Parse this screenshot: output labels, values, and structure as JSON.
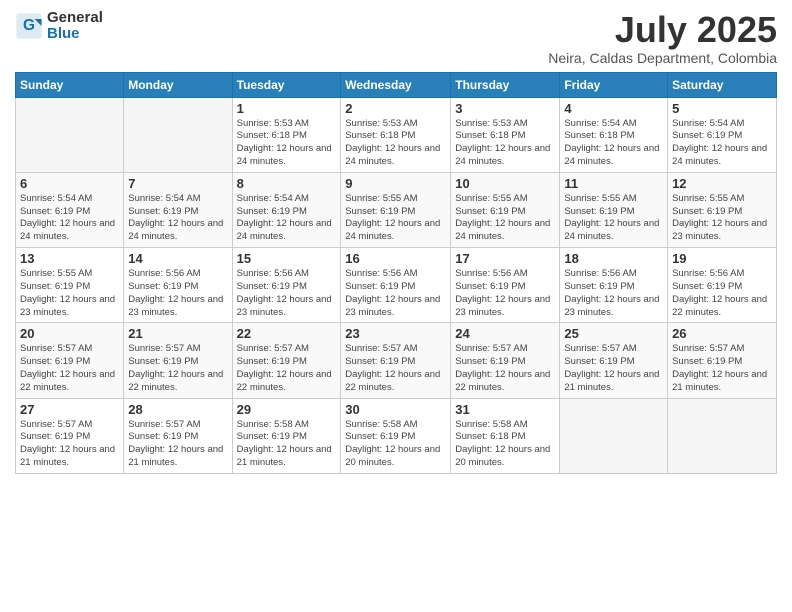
{
  "logo": {
    "text_general": "General",
    "text_blue": "Blue"
  },
  "title": {
    "month": "July 2025",
    "location": "Neira, Caldas Department, Colombia"
  },
  "weekdays": [
    "Sunday",
    "Monday",
    "Tuesday",
    "Wednesday",
    "Thursday",
    "Friday",
    "Saturday"
  ],
  "weeks": [
    [
      {
        "day": "",
        "info": ""
      },
      {
        "day": "",
        "info": ""
      },
      {
        "day": "1",
        "info": "Sunrise: 5:53 AM\nSunset: 6:18 PM\nDaylight: 12 hours and 24 minutes."
      },
      {
        "day": "2",
        "info": "Sunrise: 5:53 AM\nSunset: 6:18 PM\nDaylight: 12 hours and 24 minutes."
      },
      {
        "day": "3",
        "info": "Sunrise: 5:53 AM\nSunset: 6:18 PM\nDaylight: 12 hours and 24 minutes."
      },
      {
        "day": "4",
        "info": "Sunrise: 5:54 AM\nSunset: 6:18 PM\nDaylight: 12 hours and 24 minutes."
      },
      {
        "day": "5",
        "info": "Sunrise: 5:54 AM\nSunset: 6:19 PM\nDaylight: 12 hours and 24 minutes."
      }
    ],
    [
      {
        "day": "6",
        "info": "Sunrise: 5:54 AM\nSunset: 6:19 PM\nDaylight: 12 hours and 24 minutes."
      },
      {
        "day": "7",
        "info": "Sunrise: 5:54 AM\nSunset: 6:19 PM\nDaylight: 12 hours and 24 minutes."
      },
      {
        "day": "8",
        "info": "Sunrise: 5:54 AM\nSunset: 6:19 PM\nDaylight: 12 hours and 24 minutes."
      },
      {
        "day": "9",
        "info": "Sunrise: 5:55 AM\nSunset: 6:19 PM\nDaylight: 12 hours and 24 minutes."
      },
      {
        "day": "10",
        "info": "Sunrise: 5:55 AM\nSunset: 6:19 PM\nDaylight: 12 hours and 24 minutes."
      },
      {
        "day": "11",
        "info": "Sunrise: 5:55 AM\nSunset: 6:19 PM\nDaylight: 12 hours and 24 minutes."
      },
      {
        "day": "12",
        "info": "Sunrise: 5:55 AM\nSunset: 6:19 PM\nDaylight: 12 hours and 23 minutes."
      }
    ],
    [
      {
        "day": "13",
        "info": "Sunrise: 5:55 AM\nSunset: 6:19 PM\nDaylight: 12 hours and 23 minutes."
      },
      {
        "day": "14",
        "info": "Sunrise: 5:56 AM\nSunset: 6:19 PM\nDaylight: 12 hours and 23 minutes."
      },
      {
        "day": "15",
        "info": "Sunrise: 5:56 AM\nSunset: 6:19 PM\nDaylight: 12 hours and 23 minutes."
      },
      {
        "day": "16",
        "info": "Sunrise: 5:56 AM\nSunset: 6:19 PM\nDaylight: 12 hours and 23 minutes."
      },
      {
        "day": "17",
        "info": "Sunrise: 5:56 AM\nSunset: 6:19 PM\nDaylight: 12 hours and 23 minutes."
      },
      {
        "day": "18",
        "info": "Sunrise: 5:56 AM\nSunset: 6:19 PM\nDaylight: 12 hours and 23 minutes."
      },
      {
        "day": "19",
        "info": "Sunrise: 5:56 AM\nSunset: 6:19 PM\nDaylight: 12 hours and 22 minutes."
      }
    ],
    [
      {
        "day": "20",
        "info": "Sunrise: 5:57 AM\nSunset: 6:19 PM\nDaylight: 12 hours and 22 minutes."
      },
      {
        "day": "21",
        "info": "Sunrise: 5:57 AM\nSunset: 6:19 PM\nDaylight: 12 hours and 22 minutes."
      },
      {
        "day": "22",
        "info": "Sunrise: 5:57 AM\nSunset: 6:19 PM\nDaylight: 12 hours and 22 minutes."
      },
      {
        "day": "23",
        "info": "Sunrise: 5:57 AM\nSunset: 6:19 PM\nDaylight: 12 hours and 22 minutes."
      },
      {
        "day": "24",
        "info": "Sunrise: 5:57 AM\nSunset: 6:19 PM\nDaylight: 12 hours and 22 minutes."
      },
      {
        "day": "25",
        "info": "Sunrise: 5:57 AM\nSunset: 6:19 PM\nDaylight: 12 hours and 21 minutes."
      },
      {
        "day": "26",
        "info": "Sunrise: 5:57 AM\nSunset: 6:19 PM\nDaylight: 12 hours and 21 minutes."
      }
    ],
    [
      {
        "day": "27",
        "info": "Sunrise: 5:57 AM\nSunset: 6:19 PM\nDaylight: 12 hours and 21 minutes."
      },
      {
        "day": "28",
        "info": "Sunrise: 5:57 AM\nSunset: 6:19 PM\nDaylight: 12 hours and 21 minutes."
      },
      {
        "day": "29",
        "info": "Sunrise: 5:58 AM\nSunset: 6:19 PM\nDaylight: 12 hours and 21 minutes."
      },
      {
        "day": "30",
        "info": "Sunrise: 5:58 AM\nSunset: 6:19 PM\nDaylight: 12 hours and 20 minutes."
      },
      {
        "day": "31",
        "info": "Sunrise: 5:58 AM\nSunset: 6:18 PM\nDaylight: 12 hours and 20 minutes."
      },
      {
        "day": "",
        "info": ""
      },
      {
        "day": "",
        "info": ""
      }
    ]
  ]
}
